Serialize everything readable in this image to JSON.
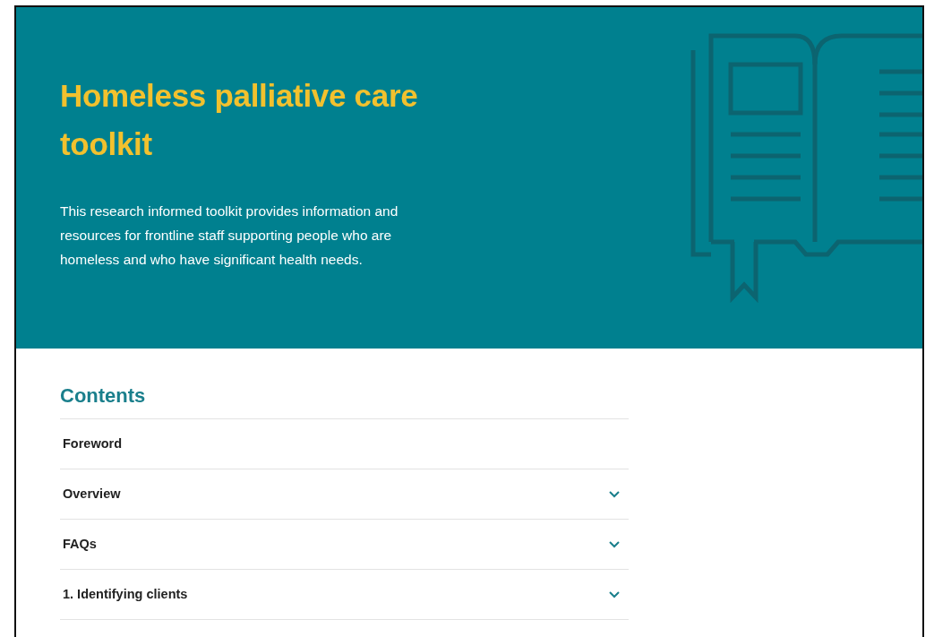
{
  "hero": {
    "title": "Homeless palliative care toolkit",
    "description": "This research informed toolkit provides information and resources for frontline staff supporting people who are homeless and who have significant health needs."
  },
  "contents": {
    "heading": "Contents",
    "items": [
      {
        "label": "Foreword",
        "expandable": false
      },
      {
        "label": "Overview",
        "expandable": true
      },
      {
        "label": "FAQs",
        "expandable": true
      },
      {
        "label": "1. Identifying clients",
        "expandable": true
      }
    ]
  }
}
